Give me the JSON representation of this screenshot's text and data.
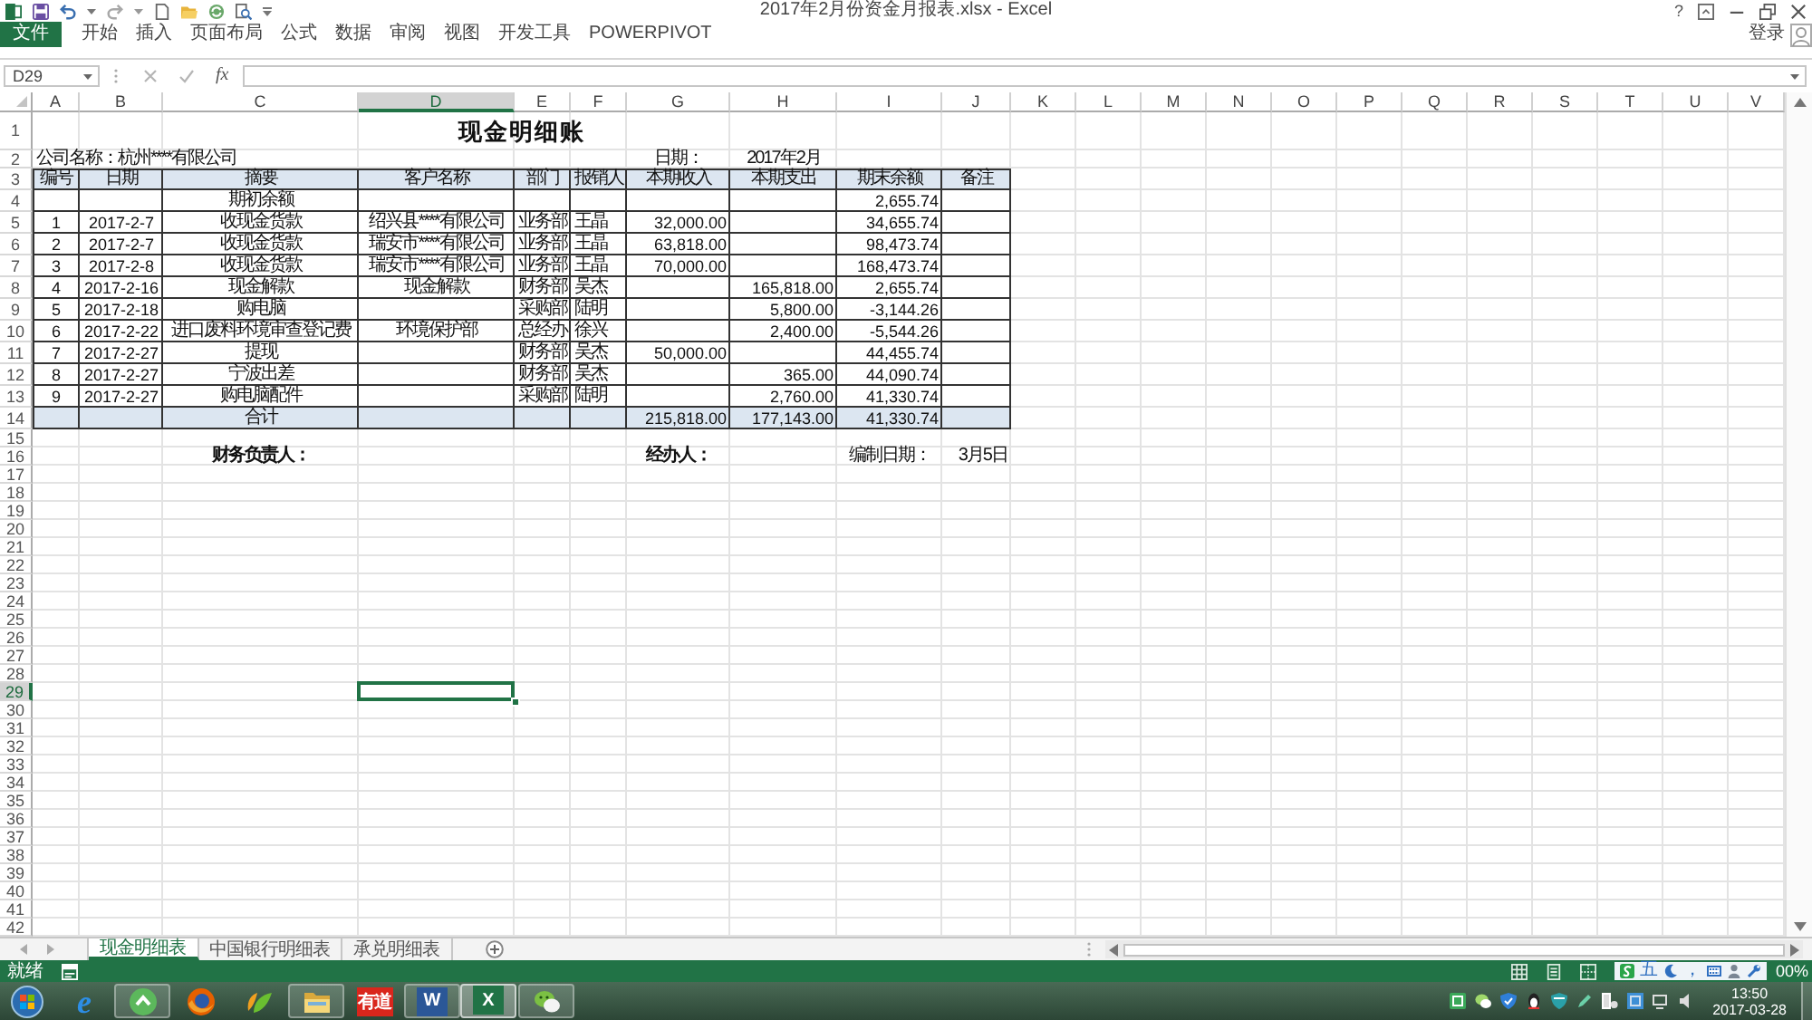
{
  "window": {
    "title": "2017年2月份资金月报表.xlsx - Excel",
    "help": "?"
  },
  "ribbon": {
    "tabs": [
      {
        "label": "文件",
        "kind": "file"
      },
      {
        "label": "开始",
        "kind": "tab"
      },
      {
        "label": "插入",
        "kind": "tab"
      },
      {
        "label": "页面布局",
        "kind": "tab"
      },
      {
        "label": "公式",
        "kind": "tab"
      },
      {
        "label": "数据",
        "kind": "tab"
      },
      {
        "label": "审阅",
        "kind": "tab"
      },
      {
        "label": "视图",
        "kind": "tab"
      },
      {
        "label": "开发工具",
        "kind": "tab"
      },
      {
        "label": "POWERPIVOT",
        "kind": "tab"
      }
    ],
    "sign_in": "登录"
  },
  "formula_bar": {
    "name_box": "D29",
    "function_button": "fx"
  },
  "columns": [
    {
      "label": "A",
      "selected": false
    },
    {
      "label": "B",
      "selected": false
    },
    {
      "label": "C",
      "selected": false
    },
    {
      "label": "D",
      "selected": true
    },
    {
      "label": "E",
      "selected": false
    },
    {
      "label": "F",
      "selected": false
    },
    {
      "label": "G",
      "selected": false
    },
    {
      "label": "H",
      "selected": false
    },
    {
      "label": "I",
      "selected": false
    },
    {
      "label": "J",
      "selected": false
    },
    {
      "label": "K",
      "selected": false
    },
    {
      "label": "L",
      "selected": false
    },
    {
      "label": "M",
      "selected": false
    },
    {
      "label": "N",
      "selected": false
    },
    {
      "label": "O",
      "selected": false
    },
    {
      "label": "P",
      "selected": false
    },
    {
      "label": "Q",
      "selected": false
    },
    {
      "label": "R",
      "selected": false
    },
    {
      "label": "S",
      "selected": false
    },
    {
      "label": "T",
      "selected": false
    },
    {
      "label": "U",
      "selected": false
    },
    {
      "label": "V",
      "selected": false
    }
  ],
  "rows": [
    {
      "label": "1",
      "selected": false
    },
    {
      "label": "2",
      "selected": false
    },
    {
      "label": "3",
      "selected": false
    },
    {
      "label": "4",
      "selected": false
    },
    {
      "label": "5",
      "selected": false
    },
    {
      "label": "6",
      "selected": false
    },
    {
      "label": "7",
      "selected": false
    },
    {
      "label": "8",
      "selected": false
    },
    {
      "label": "9",
      "selected": false
    },
    {
      "label": "10",
      "selected": false
    },
    {
      "label": "11",
      "selected": false
    },
    {
      "label": "12",
      "selected": false
    },
    {
      "label": "13",
      "selected": false
    },
    {
      "label": "14",
      "selected": false
    },
    {
      "label": "15",
      "selected": false
    },
    {
      "label": "16",
      "selected": false
    },
    {
      "label": "17",
      "selected": false
    },
    {
      "label": "18",
      "selected": false
    },
    {
      "label": "19",
      "selected": false
    },
    {
      "label": "20",
      "selected": false
    },
    {
      "label": "21",
      "selected": false
    },
    {
      "label": "22",
      "selected": false
    },
    {
      "label": "23",
      "selected": false
    },
    {
      "label": "24",
      "selected": false
    },
    {
      "label": "25",
      "selected": false
    },
    {
      "label": "26",
      "selected": false
    },
    {
      "label": "27",
      "selected": false
    },
    {
      "label": "28",
      "selected": false
    },
    {
      "label": "29",
      "selected": true
    },
    {
      "label": "30",
      "selected": false
    },
    {
      "label": "31",
      "selected": false
    },
    {
      "label": "32",
      "selected": false
    },
    {
      "label": "33",
      "selected": false
    },
    {
      "label": "34",
      "selected": false
    },
    {
      "label": "35",
      "selected": false
    },
    {
      "label": "36",
      "selected": false
    },
    {
      "label": "37",
      "selected": false
    },
    {
      "label": "38",
      "selected": false
    },
    {
      "label": "39",
      "selected": false
    },
    {
      "label": "40",
      "selected": false
    },
    {
      "label": "41",
      "selected": false
    },
    {
      "label": "42",
      "selected": false
    }
  ],
  "sheet": {
    "title": "现金明细账",
    "company": "公司名称：杭州****有限公司",
    "date_label": "日期：",
    "date": "2017年2月",
    "table": {
      "columns": [
        "编号",
        "日期",
        "摘要",
        "客户名称",
        "部门",
        "报销人",
        "本期收入",
        "本期支出",
        "期末余额",
        "备注"
      ],
      "rows": [
        {
          "summary": "期初余额",
          "balance": "2,655.74"
        },
        {
          "no": "1",
          "date": "2017-2-7",
          "summary": "收现金货款",
          "customer": "绍兴县****有限公司",
          "department": "业务部",
          "person": "王晶",
          "income": "32,000.00",
          "balance": "34,655.74"
        },
        {
          "no": "2",
          "date": "2017-2-7",
          "summary": "收现金货款",
          "customer": "瑞安市****有限公司",
          "department": "业务部",
          "person": "王晶",
          "income": "63,818.00",
          "balance": "98,473.74"
        },
        {
          "no": "3",
          "date": "2017-2-8",
          "summary": "收现金货款",
          "customer": "瑞安市****有限公司",
          "department": "业务部",
          "person": "王晶",
          "income": "70,000.00",
          "balance": "168,473.74"
        },
        {
          "no": "4",
          "date": "2017-2-16",
          "summary": "现金解款",
          "customer": "现金解款",
          "department": "财务部",
          "person": "吴杰",
          "expense": "165,818.00",
          "balance": "2,655.74"
        },
        {
          "no": "5",
          "date": "2017-2-18",
          "summary": "购电脑",
          "department": "采购部",
          "person": "陆明",
          "expense": "5,800.00",
          "balance": "-3,144.26"
        },
        {
          "no": "6",
          "date": "2017-2-22",
          "summary": "进口废料环境审查登记费",
          "customer": "环境保护部",
          "department": "总经办",
          "person": "徐兴",
          "expense": "2,400.00",
          "balance": "-5,544.26"
        },
        {
          "no": "7",
          "date": "2017-2-27",
          "summary": "提现",
          "department": "财务部",
          "person": "吴杰",
          "income": "50,000.00",
          "balance": "44,455.74"
        },
        {
          "no": "8",
          "date": "2017-2-27",
          "summary": "宁波出差",
          "department": "财务部",
          "person": "吴杰",
          "expense": "365.00",
          "balance": "44,090.74"
        },
        {
          "no": "9",
          "date": "2017-2-27",
          "summary": "购电脑配件",
          "department": "采购部",
          "person": "陆明",
          "expense": "2,760.00",
          "balance": "41,330.74"
        }
      ],
      "total": {
        "summary": "合计",
        "income": "215,818.00",
        "expense": "177,143.00",
        "balance": "41,330.74"
      }
    },
    "footer": {
      "finance_manager_label": "财务负责人：",
      "handler_label": "经办人：",
      "prepared_date_label": "编制日期：",
      "prepared_date": "3月5日"
    }
  },
  "sheet_tabs": [
    {
      "label": "现金明细表",
      "selected": true
    },
    {
      "label": "中国银行明细表",
      "selected": false
    },
    {
      "label": "承兑明细表",
      "selected": false
    }
  ],
  "status_bar": {
    "status": "就绪",
    "zoom": "00%"
  },
  "ime_toolbar": {
    "mode": "五",
    "punctuation": "，"
  },
  "taskbar": {
    "apps": [
      {
        "kind": "ie",
        "glyph": "e",
        "running": false,
        "selected": false
      },
      {
        "kind": "browser360",
        "running": true,
        "selected": false
      },
      {
        "kind": "firefox",
        "running": false,
        "selected": false
      },
      {
        "kind": "leaves",
        "running": false,
        "selected": false
      },
      {
        "kind": "explorer",
        "running": true,
        "selected": false
      },
      {
        "kind": "youdao",
        "glyph": "有道",
        "running": false,
        "selected": false
      },
      {
        "kind": "word",
        "glyph": "W",
        "running": true,
        "selected": false
      },
      {
        "kind": "excel",
        "glyph": "X",
        "running": true,
        "selected": true
      },
      {
        "kind": "wechat",
        "running": true,
        "selected": false
      }
    ],
    "time": "13:50",
    "date": "2017-03-28"
  }
}
